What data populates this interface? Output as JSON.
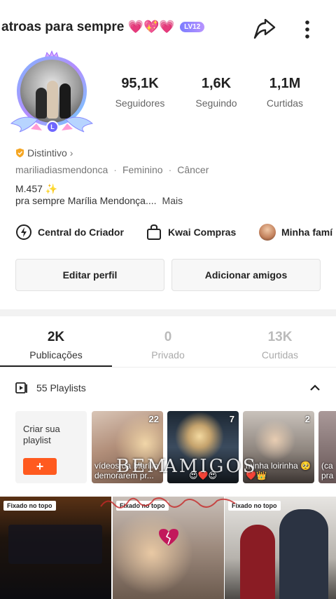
{
  "header": {
    "title": "atroas para sempre",
    "title_emojis": "💗💖💗",
    "level_badge": "LV12"
  },
  "profile": {
    "level_chip": "L",
    "stats": [
      {
        "value": "95,1K",
        "label": "Seguidores"
      },
      {
        "value": "1,6K",
        "label": "Seguindo"
      },
      {
        "value": "1,1M",
        "label": "Curtidas"
      }
    ],
    "badge_label": "Distintivo",
    "username": "mariliadiasmendonca",
    "gender": "Feminino",
    "sign": "Câncer",
    "bio_line1": "M.457 ✨",
    "bio_line2": "pra sempre Marília Mendonça....",
    "bio_more": "Mais"
  },
  "quick_links": [
    {
      "label": "Central do Criador",
      "icon": "creator-center-icon"
    },
    {
      "label": "Kwai Compras",
      "icon": "shopping-bag-icon"
    },
    {
      "label": "Minha famí",
      "icon": "avatar"
    }
  ],
  "buttons": {
    "edit_profile": "Editar perfil",
    "add_friends": "Adicionar amigos"
  },
  "tabs": [
    {
      "count": "2K",
      "label": "Publicações",
      "active": true
    },
    {
      "count": "0",
      "label": "Privado",
      "active": false
    },
    {
      "count": "13K",
      "label": "Curtidas",
      "active": false
    }
  ],
  "playlists": {
    "header": "55 Playlists",
    "create_label": "Criar sua playlist",
    "create_button": "+",
    "items": [
      {
        "count": "22",
        "title": "vídeos da Marília demorarem pr..."
      },
      {
        "count": "7",
        "title": "😍❤️😍"
      },
      {
        "count": "2",
        "title": "minha loirinha 🥺❤️👑"
      },
      {
        "count": "",
        "title": "(ca pra"
      }
    ],
    "overlay_texts": [
      "BEM",
      "AMIGOS"
    ]
  },
  "videos": [
    {
      "pin_label": "Fixado no topo"
    },
    {
      "pin_label": "Fixado no topo"
    },
    {
      "pin_label": "Fixado no topo"
    }
  ],
  "colors": {
    "accent": "#ff5a1f",
    "level_badge": "#7b7cff"
  }
}
